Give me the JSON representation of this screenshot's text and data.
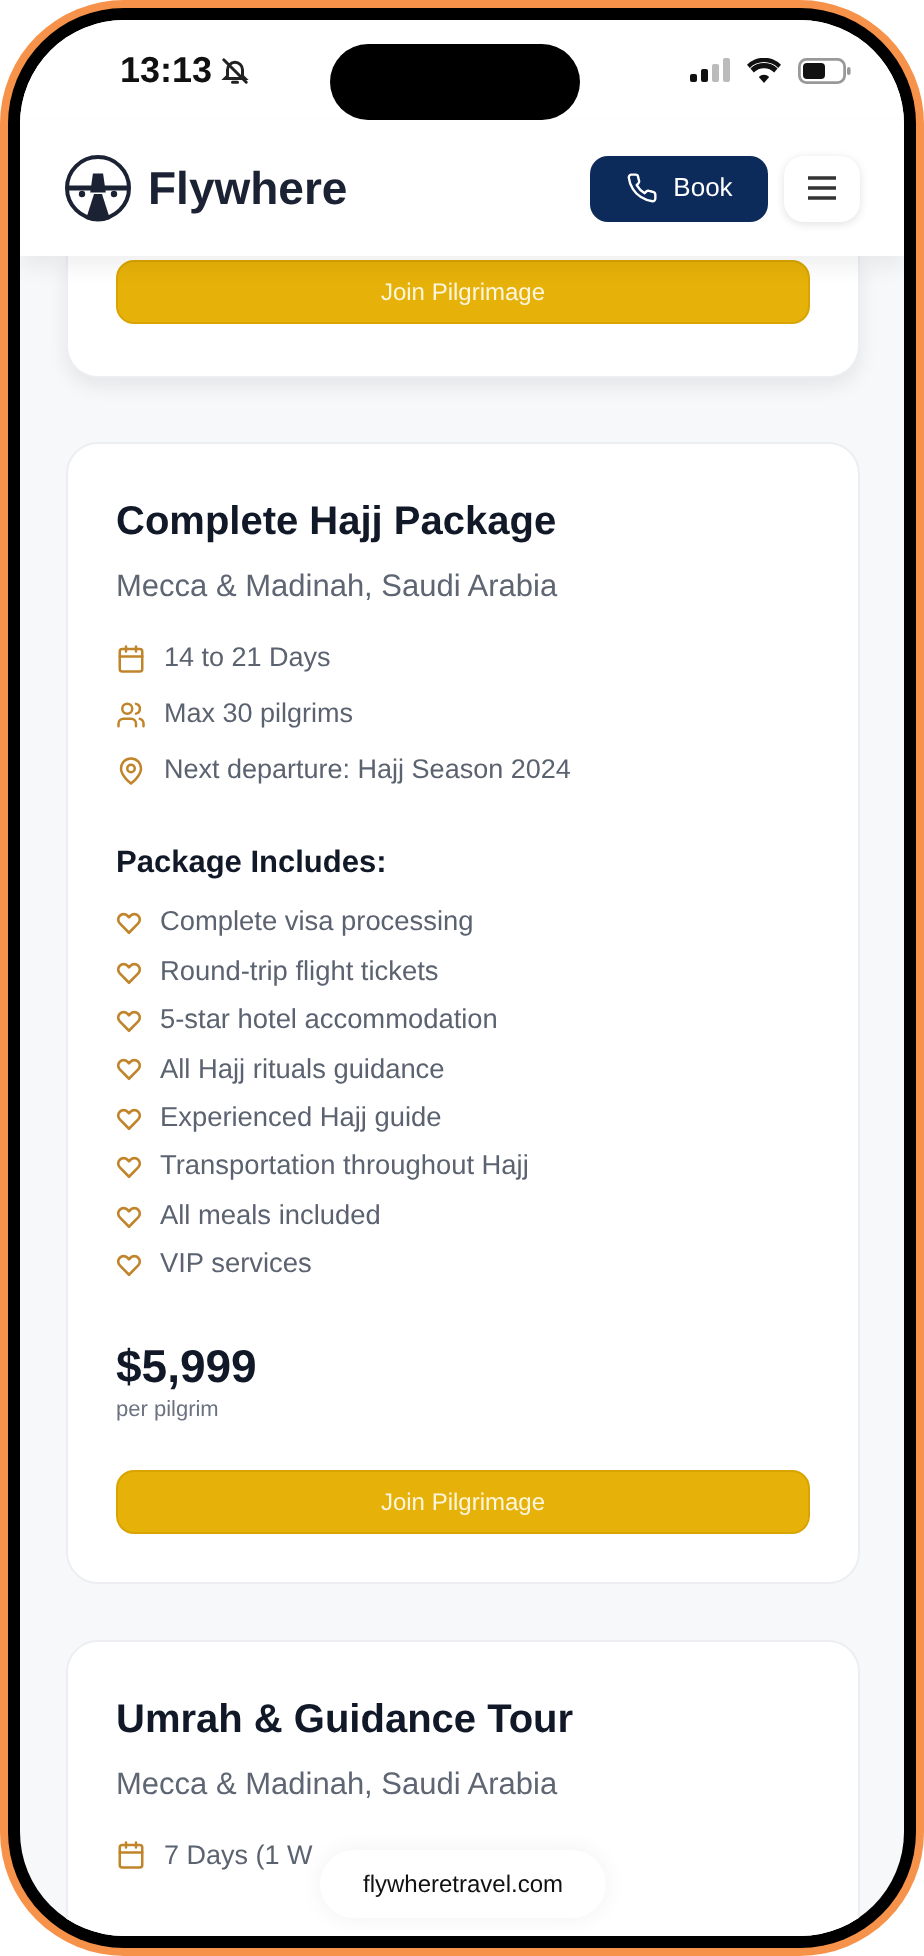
{
  "status_bar": {
    "time": "13:13",
    "silent": true
  },
  "header": {
    "brand": "Flywhere",
    "book_button": "Book"
  },
  "packages": [
    {
      "kind": "partial",
      "button": "Join Pilgrimage"
    },
    {
      "kind": "full",
      "title": "Complete Hajj Package",
      "location": "Mecca & Madinah, Saudi Arabia",
      "details": [
        {
          "kind": "calendar",
          "text": "14 to 21 Days"
        },
        {
          "kind": "people",
          "text": "Max 30 pilgrims"
        },
        {
          "kind": "pin",
          "text": "Next departure: Hajj Season 2024"
        }
      ],
      "includes_heading": "Package Includes:",
      "includes": [
        "Complete visa processing",
        "Round-trip flight tickets",
        "5-star hotel accommodation",
        "All Hajj rituals guidance",
        "Experienced Hajj guide",
        "Transportation throughout Hajj",
        "All meals included",
        "VIP services"
      ],
      "price": "$5,999",
      "price_unit": "per pilgrim",
      "button": "Join Pilgrimage"
    },
    {
      "kind": "top",
      "title": "Umrah & Guidance Tour",
      "location": "Mecca & Madinah, Saudi Arabia",
      "details": [
        {
          "kind": "calendar",
          "text": "7 Days (1 W"
        }
      ]
    }
  ],
  "url_bar": "flywheretravel.com"
}
